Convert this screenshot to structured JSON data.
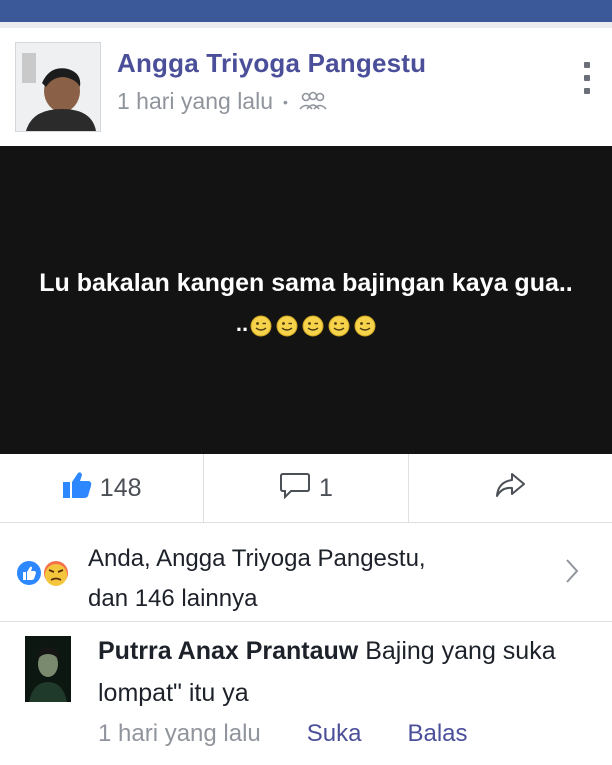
{
  "post": {
    "author": "Angga Triyoga Pangestu",
    "time": "1 hari yang lalu",
    "separator": "•",
    "audience_icon": "friends-icon",
    "menu_icon": "vertical-dots-icon",
    "image_text": "Lu bakalan kangen sama bajingan kaya gua..",
    "image_text_line2": "..",
    "emoji_count": 5
  },
  "actions": {
    "like_count": "148",
    "comment_count": "1",
    "like_icon": "thumbs-up-icon",
    "comment_icon": "comment-bubble-icon",
    "share_icon": "share-arrow-icon"
  },
  "reactions": {
    "line1": "Anda, Angga Triyoga Pangestu,",
    "line2": "dan 146 lainnya",
    "icons": [
      "like-reaction-icon",
      "angry-reaction-icon"
    ]
  },
  "comment": {
    "author": "Putrra Anax Prantauw",
    "text": " Bajing yang suka lompat\" itu ya",
    "time": "1 hari yang lalu",
    "like_label": "Suka",
    "reply_label": "Balas"
  },
  "colors": {
    "brand": "#3b5998",
    "name": "#4b4f9a",
    "like_blue": "#2d88ff",
    "angry": "#f7714c"
  }
}
